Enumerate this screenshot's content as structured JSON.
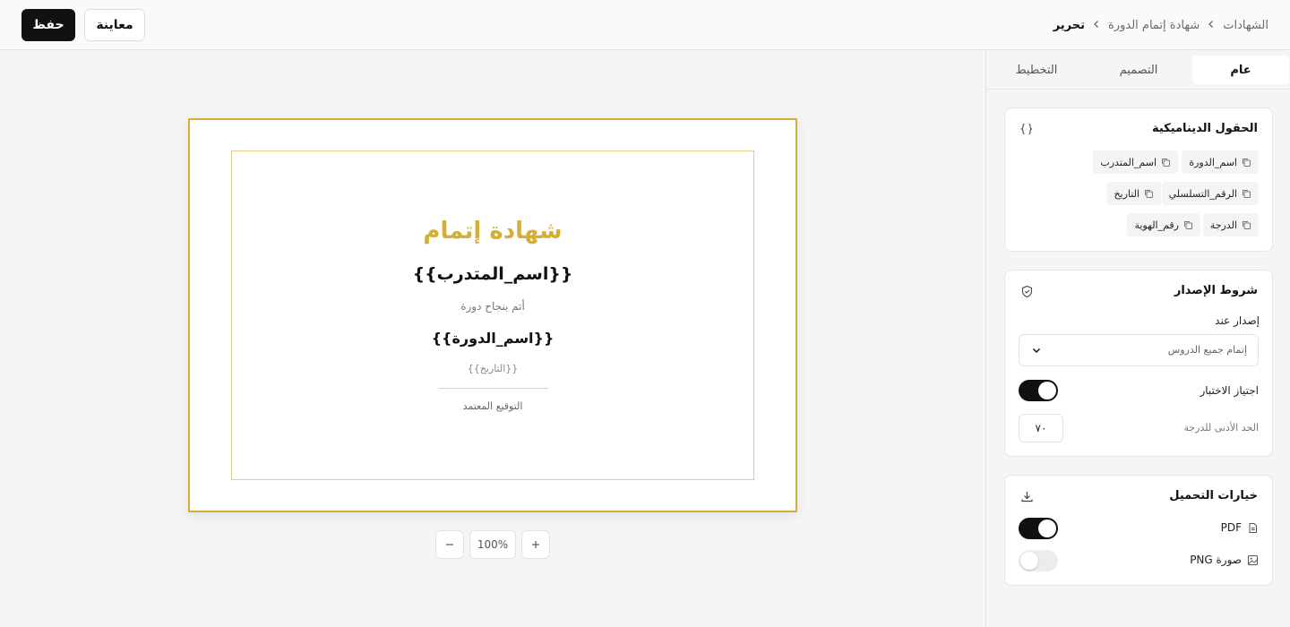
{
  "header": {
    "breadcrumb": [
      "الشهادات",
      "شهادة إتمام الدورة",
      "تحرير"
    ],
    "save_label": "حفظ",
    "preview_label": "معاينة"
  },
  "certificate": {
    "title": "شهادة إتمام",
    "name_placeholder": "{{اسم_المتدرب}}",
    "body_text": "أتم بنجاح دورة",
    "course_placeholder": "{{اسم_الدورة}}",
    "date_placeholder": "{{التاريخ}}",
    "signature_label": "التوقيع المعتمد",
    "accent_color": "#d4af37"
  },
  "zoom": {
    "value": "100%",
    "minus_icon": "minus-icon",
    "plus_icon": "plus-icon"
  },
  "tabs": [
    {
      "label": "عام",
      "active": true
    },
    {
      "label": "التصميم",
      "active": false
    },
    {
      "label": "التخطيط",
      "active": false
    }
  ],
  "dynamic_fields": {
    "title": "الحقول الديناميكية",
    "icon": "braces-icon",
    "chips": [
      "اسم_الدورة",
      "اسم_المتدرب",
      "الرقم_التسلسلي",
      "التاريخ",
      "الدرجة",
      "رقم_الهوية"
    ]
  },
  "issue_conditions": {
    "title": "شروط الإصدار",
    "icon": "shield-check-icon",
    "issue_on_label": "إصدار عند",
    "issue_on_value": "إتمام جميع الدروس",
    "pass_test_label": "اجتياز الاختبار",
    "pass_test_on": true,
    "min_grade_label": "الحد الأدنى للدرجة",
    "min_grade_value": "٧٠"
  },
  "download_options": {
    "title": "خيارات التحميل",
    "icon": "download-icon",
    "pdf_label": "PDF",
    "pdf_on": true,
    "png_label": "PNG صورة",
    "png_on": false
  }
}
